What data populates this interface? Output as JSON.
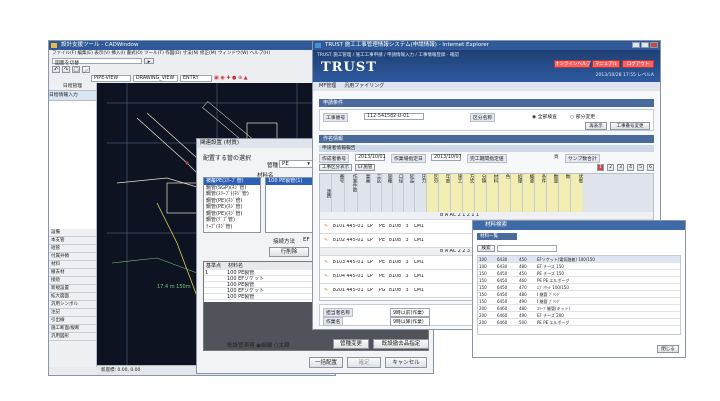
{
  "cad": {
    "title": "設計支援ツール - CADWindow",
    "menu": "ファイル(F)  編集(E)  表示(V)  挿入(I)  書式(O)  ツール(T)  作図(D)  寸法(N)  修正(M)  ウィンドウ(W)  ヘルプ(H)",
    "filter_label": "図面を切替",
    "layer_left": "PIPE-VIEW",
    "layer_right": "DRAWING_VIEW",
    "layer_mid": "ENTRY",
    "side_header": "日程情報入力",
    "side_top": "日程管理",
    "side_items": [
      "設備",
      "本支管",
      "短管",
      "付属弁類",
      "材料",
      "撤去材",
      "接続",
      "新規設置",
      "拡大図面",
      "汎用シンボル",
      "注記",
      "引出線",
      "施工断面/縦断",
      "汎用図形"
    ],
    "canvas_label": "17.4 m 150m",
    "status": "新座標: 0.00, 0.00"
  },
  "dialog": {
    "title": "関連設置 (材質)",
    "section_label": "配置する管の選択",
    "pipe_type_label": "管種",
    "pipe_type_value": "PE",
    "material_col": "材料名",
    "size_items": [
      "被覆PE(ｽﾘｰﾌﾞ管)",
      "鋼管(SGP)(ﾈｼﾞ管)",
      "鋼管(ｽﾘｰﾌﾞ)(ﾈｼﾞ管)",
      "鋼管(PE)(ﾈｼﾞ管)",
      "鋼管(PE)(ﾈｼﾞ管)",
      "鋼管(PE)(ﾈｼﾞ管)",
      "鋼管(ﾃﾞﾌﾟ管)",
      "ﾃｰﾌﾟ(ﾈｼﾞ管)"
    ],
    "material_items": [
      "100 PE製管(1)"
    ],
    "connect_label": "接続方法",
    "connect_value": "EF",
    "row_button": "行削除",
    "table_head_1": "基準点",
    "table_head_2": "材料名",
    "table_rows": [
      {
        "base": "1",
        "name": "100 PE製管"
      },
      {
        "base": "",
        "name": "100 EFソケット"
      },
      {
        "base": "",
        "name": "100 PE製管"
      },
      {
        "base": "",
        "name": "100 EFソケット"
      },
      {
        "base": "",
        "name": "100 PE製管"
      }
    ],
    "draw_line_label": "既設管表現",
    "draw_opt1": "細線",
    "draw_opt2": "太線",
    "btn_change": "管種変更",
    "btn_existing": "既設撤去品指定",
    "btn_bulk": "一括配置",
    "btn_confirm": "確定",
    "btn_cancel": "キャンセル"
  },
  "browser": {
    "title": "TRUST 施工工事管理情報システム(申請情報) - Internet Explorer",
    "breadcrumb": "TRUST 施工管理 / 施工工事申請 / 申請情報入力 / 工事情報登録 - 確認",
    "logo": "TRUST",
    "btn_online": "オンラインヘルプ",
    "btn_manual": "マニュアル",
    "btn_logout": "ログアウト",
    "date": "2013/10/28 17:55 レベルA",
    "nav_1": "MF管理",
    "nav_2": "汎用ファイリング",
    "sec1_title": "申請条件",
    "field_construction_label": "工事番号",
    "field_construction_value": "112-541582-U-01",
    "field_class_label": "区分名称",
    "radio_1": "全部検査",
    "radio_2": "部分変更",
    "btn_yell": "再表示",
    "btn_confirm2": "工事番号変更",
    "sec2_title": "作名情報",
    "sub_title": "申請者情報報告",
    "lbl_date1": "作成者番号",
    "val_date1": "2013/10/01",
    "lbl_date2": "作業場指定日",
    "val_date2": "2013/10/07",
    "lbl_note": "完工期間指定値",
    "lbl_page": "頁",
    "lbl_total": "サンプ数合計",
    "tabs": [
      "工事区分表示",
      "EF施管"
    ],
    "pager": [
      "1",
      "2",
      "3",
      "4",
      "5",
      "6"
    ],
    "grid_cols": [
      "連携",
      "番号",
      "作業件数",
      "業番",
      "工区",
      "管種",
      "口径",
      "延長",
      "圧力",
      "区分",
      "年度",
      "施工",
      "方式",
      "分類",
      "材料",
      "色",
      "処理",
      "概要",
      "条件",
      "数量",
      "数",
      "状態"
    ],
    "grid_rows": [
      {
        "no": "8101",
        "a": "445-01",
        "b": "LP",
        "c": "PE",
        "d": "8108",
        "e": "3",
        "f": "LM1"
      },
      {
        "no": "8102",
        "a": "445-01",
        "b": "LP",
        "c": "PE",
        "d": "8108",
        "e": "3",
        "f": "LM1"
      },
      {
        "no": "8103",
        "a": "445-01",
        "b": "LP",
        "c": "PE",
        "d": "8108",
        "e": "3",
        "f": "LM1"
      },
      {
        "no": "8104",
        "a": "445-01",
        "b": "LP",
        "c": "PE",
        "d": "8108",
        "e": "3",
        "f": "LM1"
      },
      {
        "no": "8201",
        "a": "445-01",
        "b": "LP",
        "c": "PG",
        "d": "8108",
        "e": "3",
        "f": "LM1"
      }
    ],
    "row_detail_1": "B  A  AC  2  1  2  1      1",
    "row_detail_2": "B  A  AC  2  2  3  1      2  1",
    "bottom_label_1": "担当者名称",
    "bottom_label_2": "作業名",
    "bottom_field_1": "9時以前(作業)",
    "bottom_field_2": "9時以降(作業)"
  },
  "popup": {
    "title": "材料検索",
    "panel": "材料一覧",
    "search_btn": "検索",
    "rows": [
      [
        "100",
        "6430",
        "450",
        "EFソケット(電気融着) 100/150"
      ],
      [
        "100",
        "6430",
        "480",
        "EF チーズ 150"
      ],
      [
        "150",
        "6450",
        "450",
        "PE チーズ 150"
      ],
      [
        "150",
        "6450",
        "460",
        "PE PE エルボーグ"
      ],
      [
        "150",
        "6450",
        "470",
        "ｴﾌﾞｿｹｯﾄ 100/150"
      ],
      [
        "150",
        "6450",
        "480",
        "I 継管 ﾌﾞﾘﾝｸﾞ"
      ],
      [
        "150",
        "6450",
        "490",
        "I 継管 ﾌﾞﾘﾝｸﾞ"
      ],
      [
        "200",
        "6460",
        "480",
        "ｽﾘｰﾌﾞ継管(キット)"
      ],
      [
        "200",
        "6460",
        "490",
        "EF チーズ 200"
      ],
      [
        "200",
        "6460",
        "500",
        "PE PE エルボーグ"
      ]
    ],
    "close_btn": "閉じる"
  }
}
